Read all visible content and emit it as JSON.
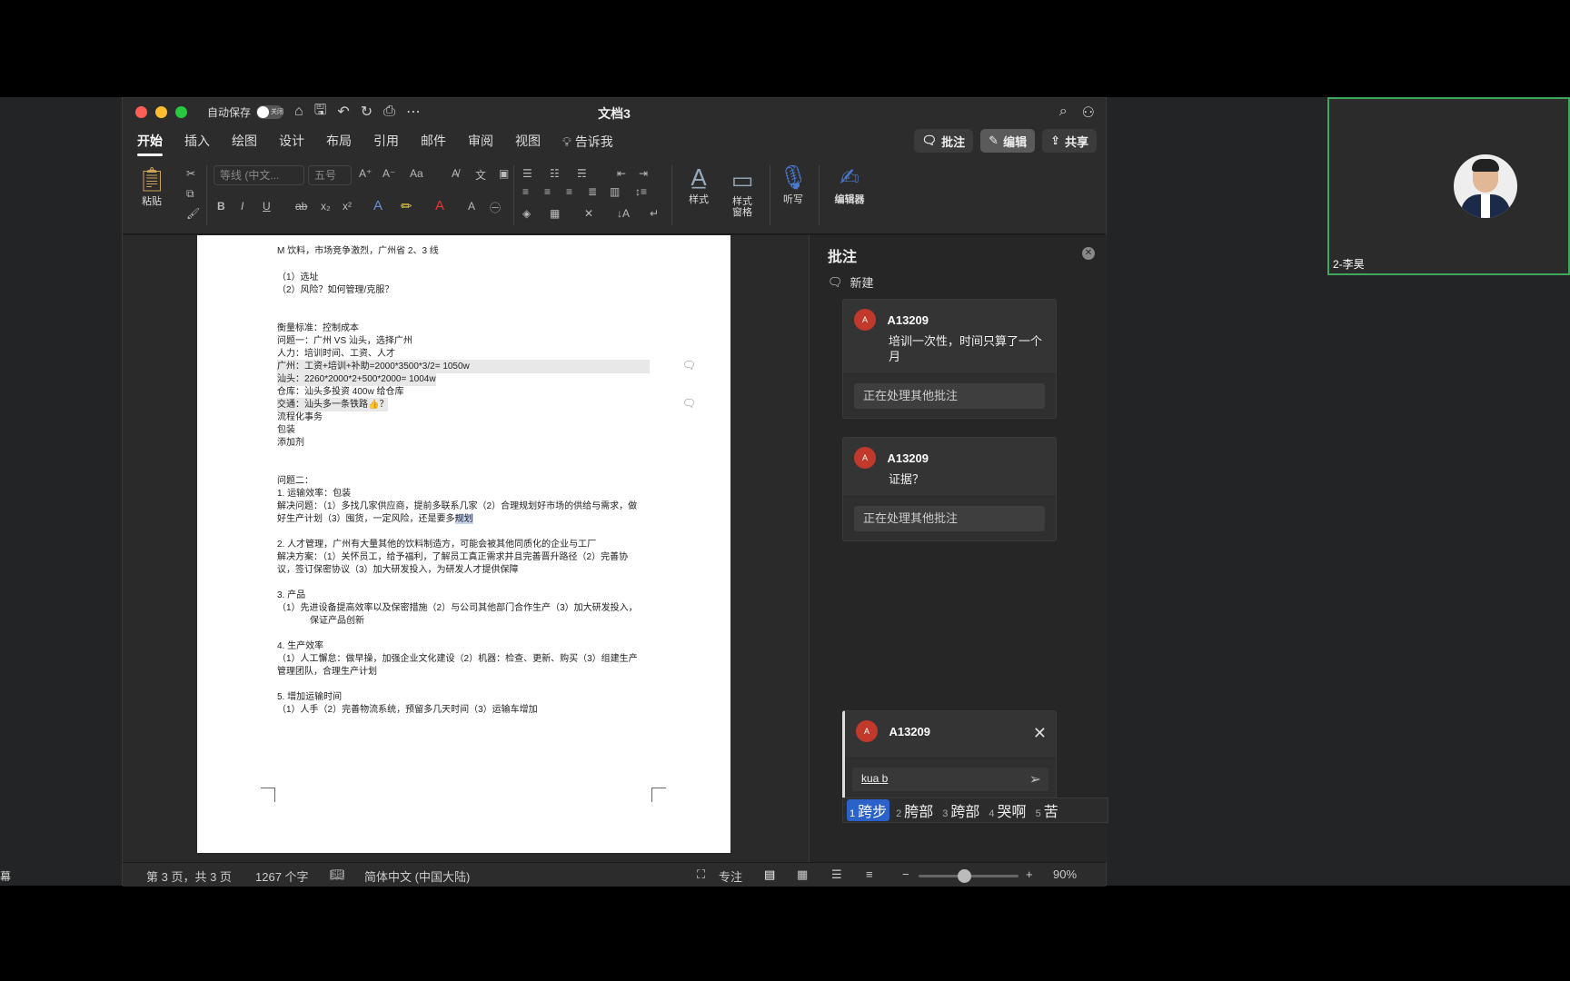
{
  "window": {
    "title": "文档3",
    "autosave_label": "自动保存",
    "autosave_state": "关闭"
  },
  "tabs": [
    "开始",
    "插入",
    "绘图",
    "设计",
    "布局",
    "引用",
    "邮件",
    "审阅",
    "视图"
  ],
  "tell_me": "告诉我",
  "tab_buttons": {
    "comments": "批注",
    "edit": "编辑",
    "share": "共享"
  },
  "ribbon": {
    "paste": "粘贴",
    "font_name": "等线 (中文...",
    "font_size": "五号",
    "styles": "样式",
    "styles_pane": "样式\n窗格",
    "dictate": "听写",
    "editor": "编辑器"
  },
  "document": {
    "lines": [
      "M 饮料，市场竞争激烈，广州省 2、3 线",
      "（1）选址",
      "（2）风险？如何管理/克服？",
      "衡量标准：控制成本",
      "问题一：广州 VS 汕头，选择广州",
      "人力：培训时间、工资、人才",
      "广州：工资+培训+补助=2000*3500*3/2= 1050w",
      "汕头：2260*2000*2+500*2000= 1004w",
      "仓库：汕头多投资 400w 给仓库",
      "交通：汕头多一条铁路👍？",
      "流程化事务",
      "包装",
      "添加剂",
      "问题二：",
      "1. 运输效率：包装",
      "解决问题：（1）多找几家供应商，提前多联系几家（2）合理规划好市场的供给与需求，做",
      "好生产计划（3）囤货，一定风险，还是要多",
      "规划",
      "2. 人才管理，广州有大量其他的饮料制造方，可能会被其他同质化的企业与工厂",
      "解决方案：（1）关怀员工，给予福利，了解员工真正需求并且完善晋升路径（2）完善协",
      "议，签订保密协议（3）加大研发投入，为研发人才提供保障",
      "3. 产品",
      "（1）先进设备提高效率以及保密措施（2）与公司其他部门合作生产（3）加大研发投入，",
      "保证产品创新",
      "4. 生产效率",
      "（1）人工懈怠：做早操，加强企业文化建设（2）机器：检查、更新、购买（3）组建生产",
      "管理团队，合理生产计划",
      "5. 增加运输时间",
      "（1）人手（2）完善物流系统，预留多几天时间（3）运输车增加"
    ]
  },
  "comments_pane": {
    "title": "批注",
    "new_label": "新建",
    "cards": [
      {
        "avatar": "A",
        "author": "A13209",
        "text": "培训一次性，时间只算了一个月",
        "reply": "正在处理其他批注"
      },
      {
        "avatar": "A",
        "author": "A13209",
        "text": "证据？",
        "reply": "正在处理其他批注"
      },
      {
        "avatar": "A",
        "author": "A13209",
        "input": "kua b"
      }
    ],
    "ime_candidates": [
      {
        "n": "1",
        "text": "跨步"
      },
      {
        "n": "2",
        "text": "胯部"
      },
      {
        "n": "3",
        "text": "跨部"
      },
      {
        "n": "4",
        "text": "哭啊"
      },
      {
        "n": "5",
        "text": "苦"
      }
    ]
  },
  "status": {
    "page": "第 3 页，共 3 页",
    "words": "1267 个字",
    "language": "简体中文 (中国大陆)",
    "focus": "专注",
    "zoom": "90%",
    "zoom_level": 0.45
  },
  "video": {
    "name": "2-李昊"
  },
  "stage": {
    "left_label": "幕"
  },
  "colors": {
    "accent": "#2a62c9",
    "avatar": "#c0392b",
    "video_border": "#3fa65a"
  }
}
